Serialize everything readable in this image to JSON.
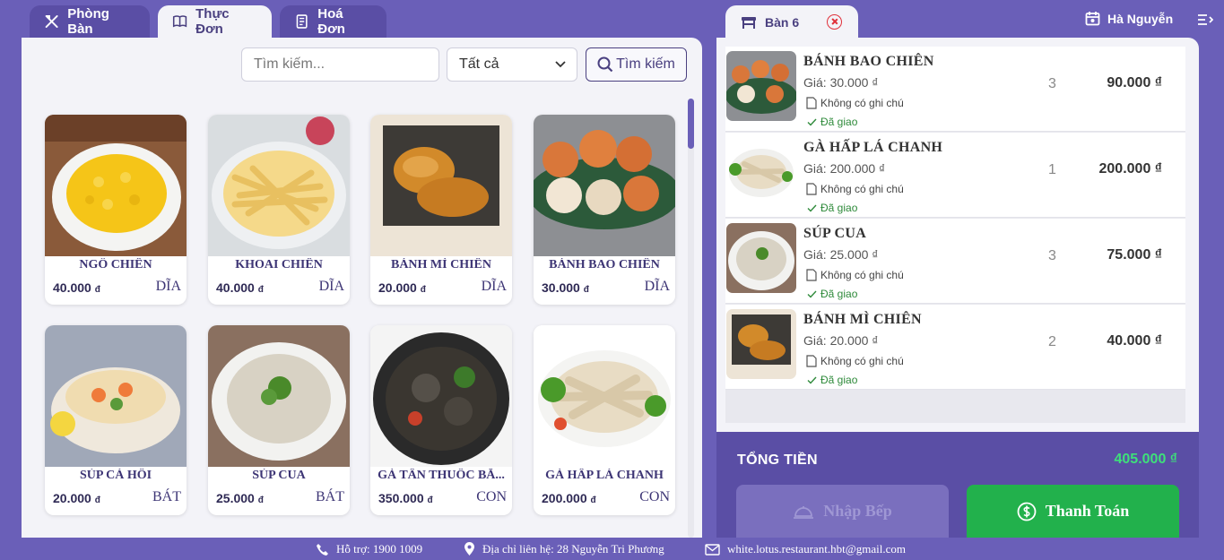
{
  "tabs": [
    {
      "label": "Phòng Bàn"
    },
    {
      "label": "Thực Đơn"
    },
    {
      "label": "Hoá Đơn"
    }
  ],
  "search": {
    "placeholder": "Tìm kiếm...",
    "category": "Tất cả",
    "button": "Tìm kiếm"
  },
  "menu": [
    {
      "name": "NGÔ CHIÊN",
      "price": "40.000",
      "currency": "đ",
      "unit": "DĨA"
    },
    {
      "name": "KHOAI CHIÊN",
      "price": "40.000",
      "currency": "đ",
      "unit": "DĨA"
    },
    {
      "name": "BÁNH MÌ CHIÊN",
      "price": "20.000",
      "currency": "đ",
      "unit": "DĨA"
    },
    {
      "name": "BÁNH BAO CHIÊN",
      "price": "30.000",
      "currency": "đ",
      "unit": "DĨA"
    },
    {
      "name": "SÚP CÁ HỒI",
      "price": "20.000",
      "currency": "đ",
      "unit": "BÁT"
    },
    {
      "name": "SÚP CUA",
      "price": "25.000",
      "currency": "đ",
      "unit": "BÁT"
    },
    {
      "name": "GÀ TẦN THUỐC BẮ...",
      "price": "350.000",
      "currency": "đ",
      "unit": "CON"
    },
    {
      "name": "GÀ HẤP LÁ CHANH",
      "price": "200.000",
      "currency": "đ",
      "unit": "CON"
    }
  ],
  "table": {
    "label": "Bàn 6"
  },
  "user": {
    "name": "Hà Nguyễn"
  },
  "order": [
    {
      "name": "BÁNH BAO CHIÊN",
      "price": "Giá: 30.000 ₫",
      "note": "Không có ghi chú",
      "status": "Đã giao",
      "qty": "3",
      "total": "90.000 ₫"
    },
    {
      "name": "GÀ HẤP LÁ CHANH",
      "price": "Giá: 200.000 ₫",
      "note": "Không có ghi chú",
      "status": "Đã giao",
      "qty": "1",
      "total": "200.000 ₫"
    },
    {
      "name": "SÚP CUA",
      "price": "Giá: 25.000 ₫",
      "note": "Không có ghi chú",
      "status": "Đã giao",
      "qty": "3",
      "total": "75.000 ₫"
    },
    {
      "name": "BÁNH MÌ CHIÊN",
      "price": "Giá: 20.000 ₫",
      "note": "Không có ghi chú",
      "status": "Đã giao",
      "qty": "2",
      "total": "40.000 ₫"
    }
  ],
  "summary": {
    "label": "TỔNG TIỀN",
    "value": "405.000 ₫"
  },
  "actions": {
    "kitchen": "Nhập Bếp",
    "pay": "Thanh Toán"
  },
  "footer": {
    "support": "Hỗ trợ: 1900 1009",
    "address": "Địa chỉ liên hệ: 28 Nguyễn Tri Phương",
    "email": "white.lotus.restaurant.hbt@gmail.com"
  },
  "colors": {
    "primary": "#6a5fb8",
    "dark": "#5a4ea5",
    "pay": "#22b14c",
    "total": "#3ee07a"
  }
}
